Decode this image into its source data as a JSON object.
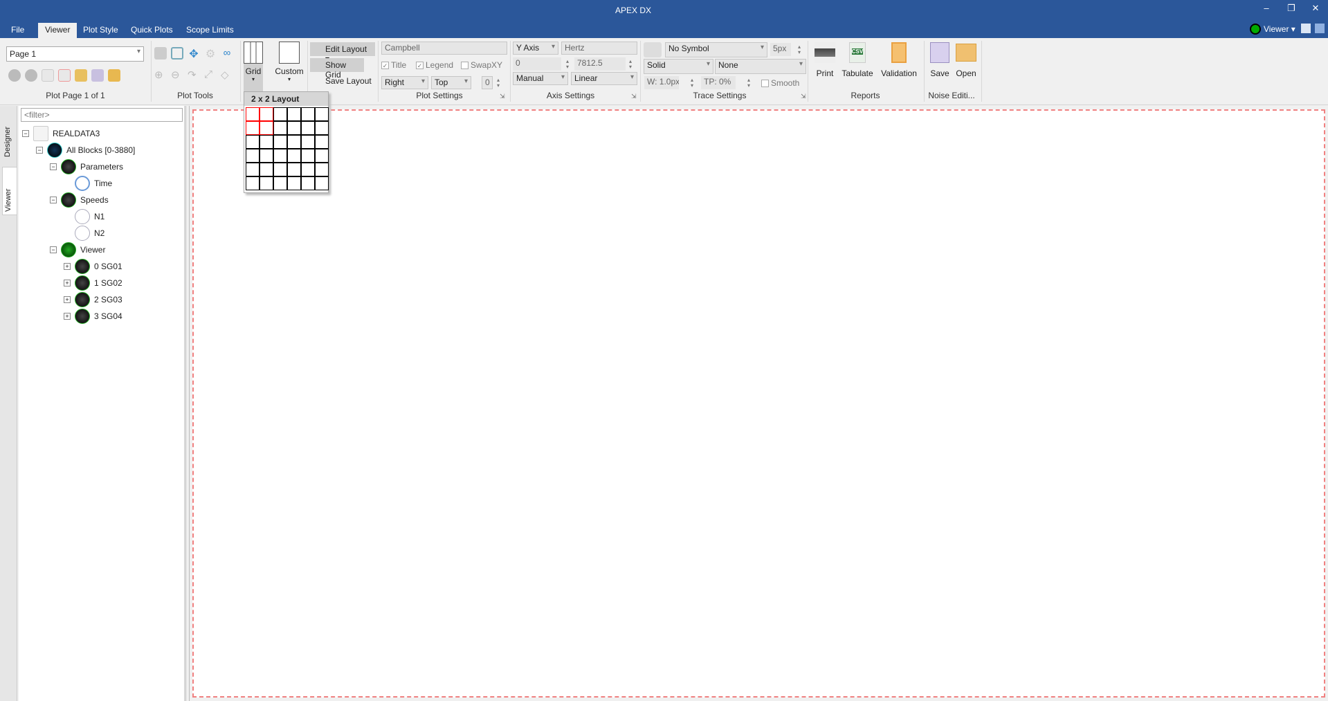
{
  "window": {
    "title": "APEX DX",
    "controls": [
      "–",
      "❐",
      "✕"
    ]
  },
  "tabs": [
    {
      "label": "File"
    },
    {
      "label": "Viewer",
      "active": true
    },
    {
      "label": "Plot Style"
    },
    {
      "label": "Quick Plots"
    },
    {
      "label": "Scope Limits"
    }
  ],
  "profile": {
    "label": "Viewer"
  },
  "ribbon": {
    "plot_page": {
      "page_select": "Page 1",
      "group_label": "Plot Page 1 of 1"
    },
    "plot_tools": {
      "group_label": "Plot Tools"
    },
    "layout": {
      "grid_label": "Grid",
      "custom_label": "Custom",
      "edit_layout": "Edit Layout",
      "show_grid": "Show Grid",
      "save_layout": "Save Layout"
    },
    "plot_settings": {
      "title_value": "Campbell",
      "title_check": "Title",
      "legend_check": "Legend",
      "swapxy_check": "SwapXY",
      "legend_h": "Right",
      "legend_v": "Top",
      "offset": "0",
      "group_label": "Plot Settings"
    },
    "axis_settings": {
      "axis": "Y Axis",
      "unit": "Hertz",
      "min": "0",
      "max": "7812.5",
      "mode": "Manual",
      "scale": "Linear",
      "group_label": "Axis Settings"
    },
    "trace_settings": {
      "symbol": "No Symbol",
      "symbol_size": "5px",
      "line_style": "Solid",
      "fill": "None",
      "width": "W: 1.0px",
      "transparency": "TP: 0%",
      "smooth": "Smooth",
      "group_label": "Trace Settings"
    },
    "reports": {
      "print": "Print",
      "tabulate": "Tabulate",
      "validation": "Validation",
      "group_label": "Reports"
    },
    "noise": {
      "save": "Save",
      "open": "Open",
      "group_label": "Noise Editi..."
    }
  },
  "grid_dropdown": {
    "header": "2 x 2 Layout",
    "rows": 6,
    "cols": 6,
    "selected_rows": 2,
    "selected_cols": 2
  },
  "side_tabs": [
    {
      "label": "Designer"
    },
    {
      "label": "Viewer"
    }
  ],
  "tree": {
    "filter_placeholder": "<filter>",
    "nodes": [
      {
        "label": "REALDATA3",
        "level": 0,
        "exp": "−",
        "icon": "file"
      },
      {
        "label": "All Blocks [0-3880]",
        "level": 1,
        "exp": "−",
        "icon": "blocks"
      },
      {
        "label": "Parameters",
        "level": 2,
        "exp": "−",
        "icon": "gauge"
      },
      {
        "label": "Time",
        "level": 3,
        "exp": "",
        "icon": "stopwatch"
      },
      {
        "label": "Speeds",
        "level": 2,
        "exp": "−",
        "icon": "gauge"
      },
      {
        "label": "N1",
        "level": 3,
        "exp": "",
        "icon": "speedometer"
      },
      {
        "label": "N2",
        "level": 3,
        "exp": "",
        "icon": "speedometer"
      },
      {
        "label": "Viewer",
        "level": 2,
        "exp": "−",
        "icon": "binoculars"
      },
      {
        "label": "0 SG01",
        "level": 3,
        "exp": "+",
        "icon": "signal"
      },
      {
        "label": "1 SG02",
        "level": 3,
        "exp": "+",
        "icon": "signal"
      },
      {
        "label": "2 SG03",
        "level": 3,
        "exp": "+",
        "icon": "signal"
      },
      {
        "label": "3 SG04",
        "level": 3,
        "exp": "+",
        "icon": "signal"
      }
    ]
  },
  "colors": {
    "titlebar": "#2b579a",
    "selection": "#ff0000",
    "plot_border": "#f08080"
  }
}
